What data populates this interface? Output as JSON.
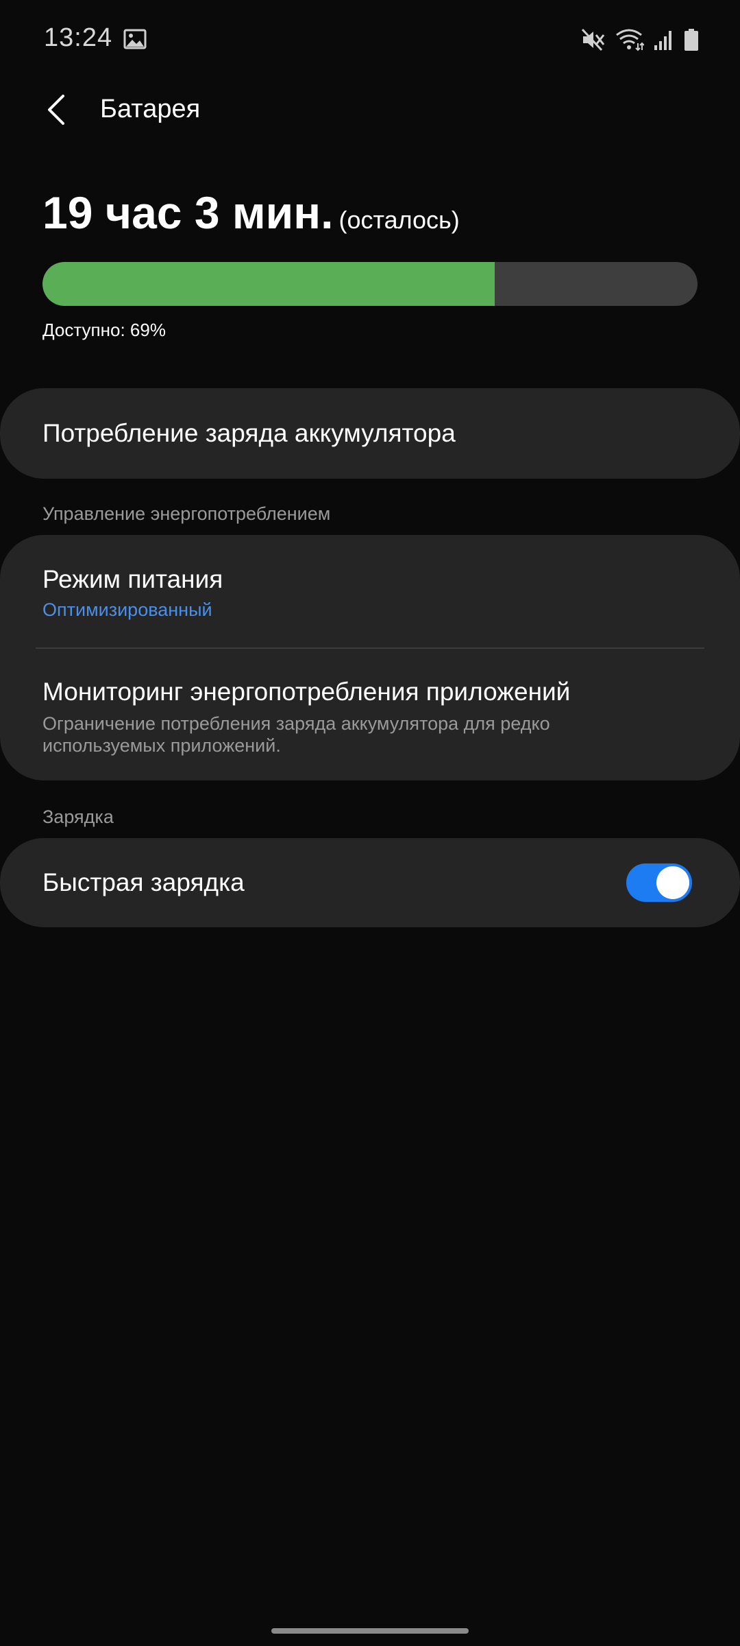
{
  "status_bar": {
    "time": "13:24",
    "icons": [
      "gallery-icon",
      "mute-icon",
      "wifi-icon",
      "signal-icon",
      "battery-icon"
    ]
  },
  "app_bar": {
    "title": "Батарея"
  },
  "battery": {
    "remaining_time": "19 час 3 мин.",
    "remaining_suffix": "(осталось)",
    "available_label": "Доступно: 69%",
    "level_percent": 69,
    "colors": {
      "fill": "#5aaf56",
      "track": "#3e3e3e"
    }
  },
  "usage": {
    "label": "Потребление заряда аккумулятора"
  },
  "power_management": {
    "header": "Управление энергопотреблением",
    "power_mode": {
      "title": "Режим питания",
      "value": "Оптимизированный",
      "value_color": "#4a8fe8"
    },
    "app_monitor": {
      "title": "Мониторинг энергопотребления приложений",
      "description_line1": "Ограничение потребления заряда аккумулятора для редко",
      "description_line2": "используемых приложений."
    }
  },
  "charging": {
    "header": "Зарядка",
    "fast_charging": {
      "label": "Быстрая зарядка",
      "enabled": true,
      "accent_color": "#1e7cf2"
    }
  }
}
